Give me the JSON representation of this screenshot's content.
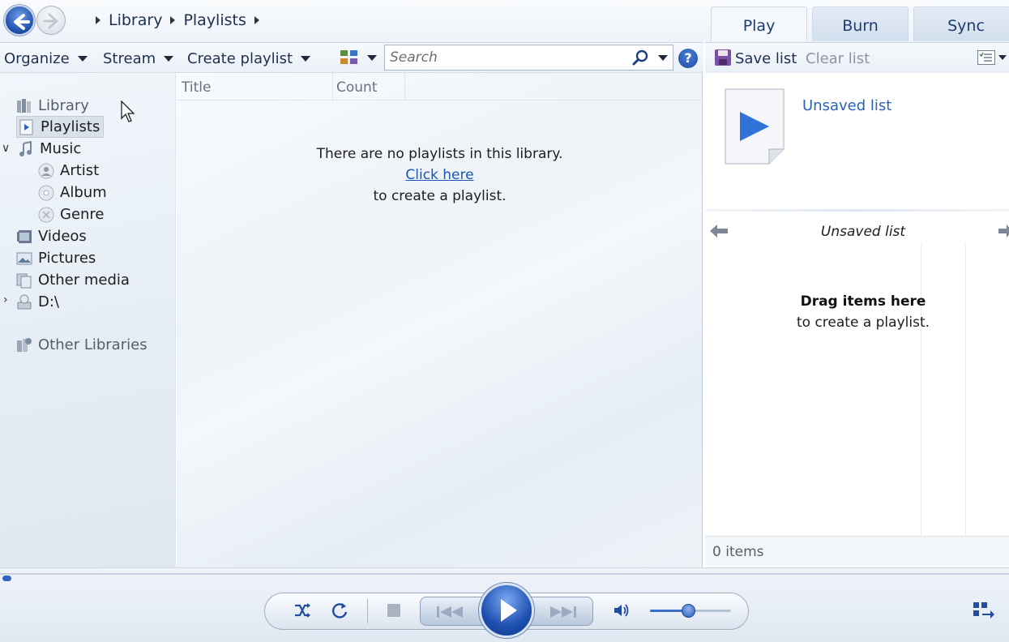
{
  "breadcrumb": [
    "Library",
    "Playlists"
  ],
  "tabs": {
    "play": "Play",
    "burn": "Burn",
    "sync": "Sync"
  },
  "toolbar": {
    "organize": "Organize",
    "stream": "Stream",
    "create_playlist": "Create playlist",
    "search_placeholder": "Search",
    "help": "?"
  },
  "list_toolbar": {
    "save": "Save list",
    "clear": "Clear list"
  },
  "nav": {
    "library": "Library",
    "playlists": "Playlists",
    "music": "Music",
    "artist": "Artist",
    "album": "Album",
    "genre": "Genre",
    "videos": "Videos",
    "pictures": "Pictures",
    "other_media": "Other media",
    "drive": "D:\\",
    "other_libraries": "Other Libraries"
  },
  "columns": {
    "title": "Title",
    "count": "Count"
  },
  "empty": {
    "line1": "There are no playlists in this library.",
    "link": "Click here",
    "line2": "to create a playlist."
  },
  "list_pane": {
    "unsaved_link": "Unsaved list",
    "unsaved_title": "Unsaved list",
    "drag_title": "Drag items here",
    "drag_sub": "to create a playlist.",
    "items": "0 items"
  },
  "player": {
    "volume_level": 0.47,
    "seek_position": 0.0
  },
  "colors": {
    "accent": "#1c4fb0",
    "link": "#1a55b8"
  },
  "icons": [
    "back-icon",
    "forward-icon",
    "search-icon",
    "help-icon",
    "save-icon",
    "play-icon",
    "shuffle-icon",
    "repeat-icon",
    "volume-icon"
  ]
}
